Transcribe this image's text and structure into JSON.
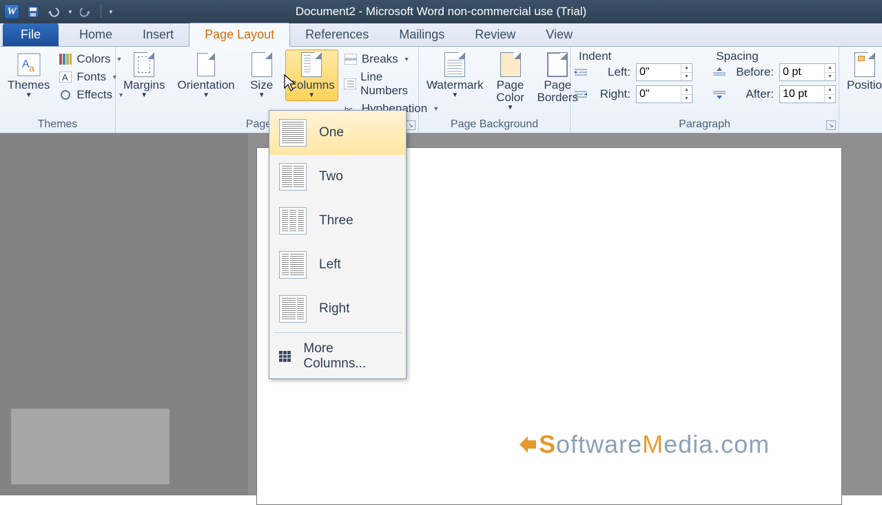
{
  "title": "Document2  -  Microsoft Word non-commercial use (Trial)",
  "tabs": {
    "file": "File",
    "home": "Home",
    "insert": "Insert",
    "page_layout": "Page Layout",
    "references": "References",
    "mailings": "Mailings",
    "review": "Review",
    "view": "View"
  },
  "groups": {
    "themes": {
      "label": "Themes",
      "themes_btn": "Themes",
      "colors": "Colors",
      "fonts": "Fonts",
      "effects": "Effects"
    },
    "page_setup": {
      "label": "Page Se",
      "margins": "Margins",
      "orientation": "Orientation",
      "size": "Size",
      "columns": "Columns",
      "breaks": "Breaks",
      "line_numbers": "Line Numbers",
      "hyphenation": "Hyphenation"
    },
    "page_background": {
      "label": "Page Background",
      "watermark": "Watermark",
      "page_color": "Page\nColor",
      "page_borders": "Page\nBorders"
    },
    "paragraph": {
      "label": "Paragraph",
      "indent_title": "Indent",
      "spacing_title": "Spacing",
      "left_label": "Left:",
      "right_label": "Right:",
      "before_label": "Before:",
      "after_label": "After:",
      "left_val": "0\"",
      "right_val": "0\"",
      "before_val": "0 pt",
      "after_val": "10 pt"
    },
    "arrange": {
      "position": "Positio"
    }
  },
  "columns_menu": {
    "one": "One",
    "two": "Two",
    "three": "Three",
    "left": "Left",
    "right": "Right",
    "more": "More Columns..."
  },
  "watermark_text": {
    "pre": "S",
    "mid": "oftware",
    "m": "M",
    "post": "edia.com"
  }
}
